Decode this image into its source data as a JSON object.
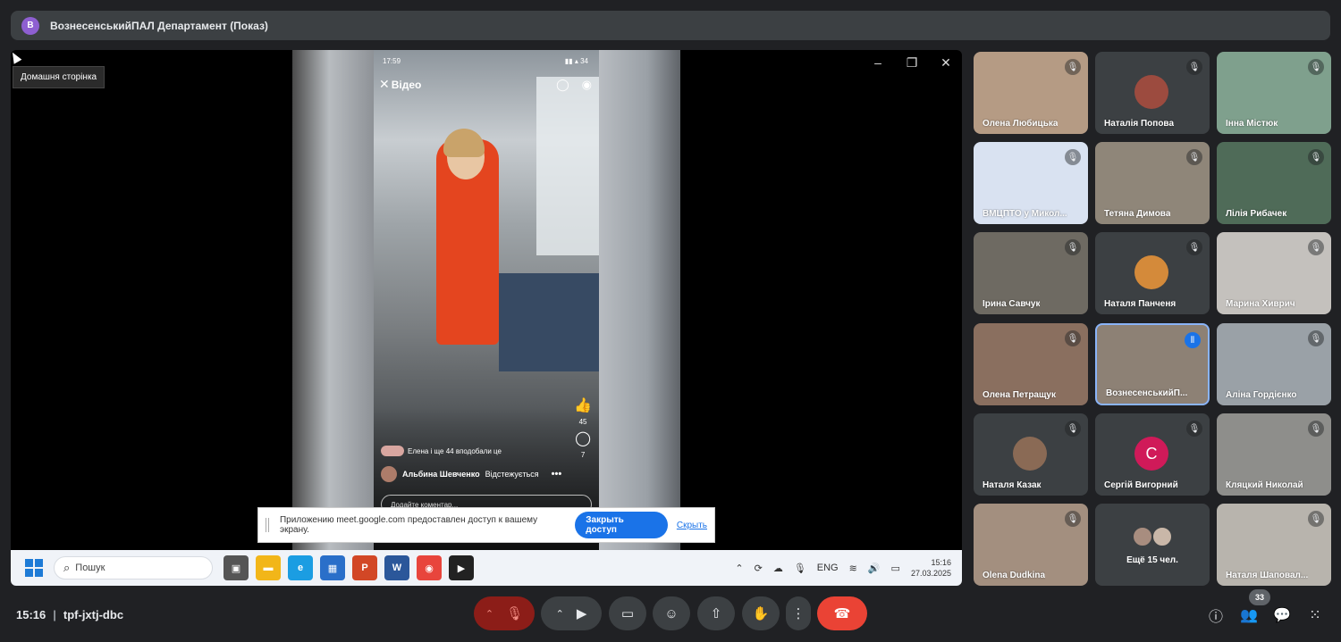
{
  "presentation": {
    "avatar_letter": "В",
    "title": "ВознесенськийПАЛ Департамент (Показ)"
  },
  "shared_screen": {
    "tooltip": "Домашня сторінка",
    "window_controls": {
      "minimize": "–",
      "restore": "❐",
      "close": "✕"
    },
    "phone": {
      "time": "17:59",
      "status_right": "▮▮ ▴ 34",
      "header_title": "Відео",
      "likes_count": "45",
      "comments_count": "7",
      "likes_text": "Елена і ще 44 вподобали це",
      "author": "Альбина Шевченко",
      "follow_label": "Відстежується",
      "comment_placeholder": "Додайте коментар..."
    },
    "share_banner": {
      "text": "Приложению meet.google.com предоставлен доступ к вашему экрану.",
      "stop_button": "Закрыть доступ",
      "hide_link": "Скрыть"
    },
    "taskbar": {
      "search_placeholder": "Пошук",
      "lang": "ENG",
      "time": "15:16",
      "date": "27.03.2025"
    }
  },
  "participants": [
    {
      "name": "Олена Любицька",
      "muted": true,
      "color": "#b59b84"
    },
    {
      "name": "Наталія Попова",
      "muted": true,
      "color": "#3c4043"
    },
    {
      "name": "Інна Містюк",
      "muted": true,
      "color": "#7fa08d"
    },
    {
      "name": "ВМЦПТО у Микол...",
      "muted": true,
      "color": "#d9e2f1"
    },
    {
      "name": "Тетяна Димова",
      "muted": true,
      "color": "#8f8679"
    },
    {
      "name": "Лілія Рибачек",
      "muted": true,
      "color": "#4f6b58"
    },
    {
      "name": "Ірина Савчук",
      "muted": true,
      "color": "#6e6a62"
    },
    {
      "name": "Наталя Панченя",
      "muted": true,
      "color": "#3c4043"
    },
    {
      "name": "Марина Хиврич",
      "muted": true,
      "color": "#c4c1bd"
    },
    {
      "name": "Олена Петращук",
      "muted": true,
      "color": "#8a6f5f"
    },
    {
      "name": "ВознесенськийП...",
      "muted": false,
      "color": "#8d8175"
    },
    {
      "name": "Аліна Гордієнко",
      "muted": true,
      "color": "#9aa1a7"
    },
    {
      "name": "Наталя Казак",
      "muted": true,
      "color": "#3c4043"
    },
    {
      "name": "Сергій Вигорний",
      "muted": true,
      "color": "#3c4043"
    },
    {
      "name": "Кляцкий Николай",
      "muted": true,
      "color": "#8e8e8b"
    },
    {
      "name": "Olena Dudkina",
      "muted": true,
      "color": "#a38f7f"
    },
    {
      "name": "Ещё 15 чел.",
      "muted": false,
      "color": "#3c4043"
    },
    {
      "name": "Наталя Шаповал...",
      "muted": true,
      "color": "#b8b4ad"
    }
  ],
  "avatars": {
    "sergii_letter": "С",
    "sergii_color": "#d01a59"
  },
  "bottom_bar": {
    "time": "15:16",
    "meeting_code": "tpf-jxtj-dbc",
    "people_count": "33"
  },
  "icons": {
    "mic_off": "mic-off-icon",
    "camera": "camera-icon",
    "captions": "captions-icon",
    "emoji": "emoji-icon",
    "present": "present-icon",
    "hand": "raise-hand-icon",
    "more": "more-vert-icon",
    "hangup": "hangup-icon",
    "info": "info-icon",
    "people": "people-icon",
    "chat": "chat-icon",
    "activities": "apps-icon"
  }
}
